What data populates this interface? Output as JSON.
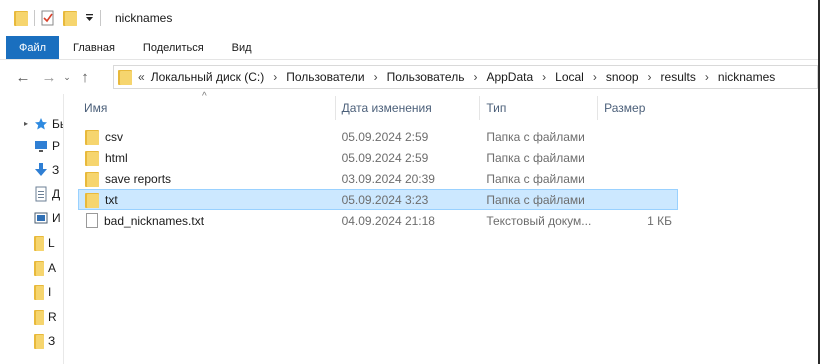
{
  "window": {
    "title": "nicknames"
  },
  "ribbon": {
    "tabs": [
      "Файл",
      "Главная",
      "Поделиться",
      "Вид"
    ]
  },
  "address": {
    "overflow": "«",
    "crumbs": [
      "Локальный диск (C:)",
      "Пользователи",
      "Пользователь",
      "AppData",
      "Local",
      "snoop",
      "results",
      "nicknames"
    ]
  },
  "navpane": {
    "items": [
      {
        "label": "Бы",
        "icon": "star-icon"
      },
      {
        "label": "Р",
        "icon": "desktop-icon"
      },
      {
        "label": "З",
        "icon": "download-icon"
      },
      {
        "label": "Д",
        "icon": "document-icon"
      },
      {
        "label": "И",
        "icon": "pictures-icon"
      },
      {
        "label": "L",
        "icon": "folder-icon"
      },
      {
        "label": "А",
        "icon": "folder-icon"
      },
      {
        "label": "I",
        "icon": "folder-icon"
      },
      {
        "label": "R",
        "icon": "folder-icon"
      },
      {
        "label": "З",
        "icon": "folder-icon"
      }
    ]
  },
  "list": {
    "columns": {
      "name": "Имя",
      "date": "Дата изменения",
      "type": "Тип",
      "size": "Размер"
    },
    "rows": [
      {
        "name": "csv",
        "date": "05.09.2024 2:59",
        "type": "Папка с файлами",
        "size": "",
        "icon": "folder-icon",
        "selected": false
      },
      {
        "name": "html",
        "date": "05.09.2024 2:59",
        "type": "Папка с файлами",
        "size": "",
        "icon": "folder-icon",
        "selected": false
      },
      {
        "name": "save reports",
        "date": "03.09.2024 20:39",
        "type": "Папка с файлами",
        "size": "",
        "icon": "folder-icon",
        "selected": false
      },
      {
        "name": "txt",
        "date": "05.09.2024 3:23",
        "type": "Папка с файлами",
        "size": "",
        "icon": "folder-icon",
        "selected": true
      },
      {
        "name": "bad_nicknames.txt",
        "date": "04.09.2024 21:18",
        "type": "Текстовый докум...",
        "size": "1 КБ",
        "icon": "text-file-icon",
        "selected": false
      }
    ]
  },
  "colors": {
    "accent": "#1a6fbf",
    "selection": "#cce8ff",
    "folder": "#f6d56e"
  }
}
